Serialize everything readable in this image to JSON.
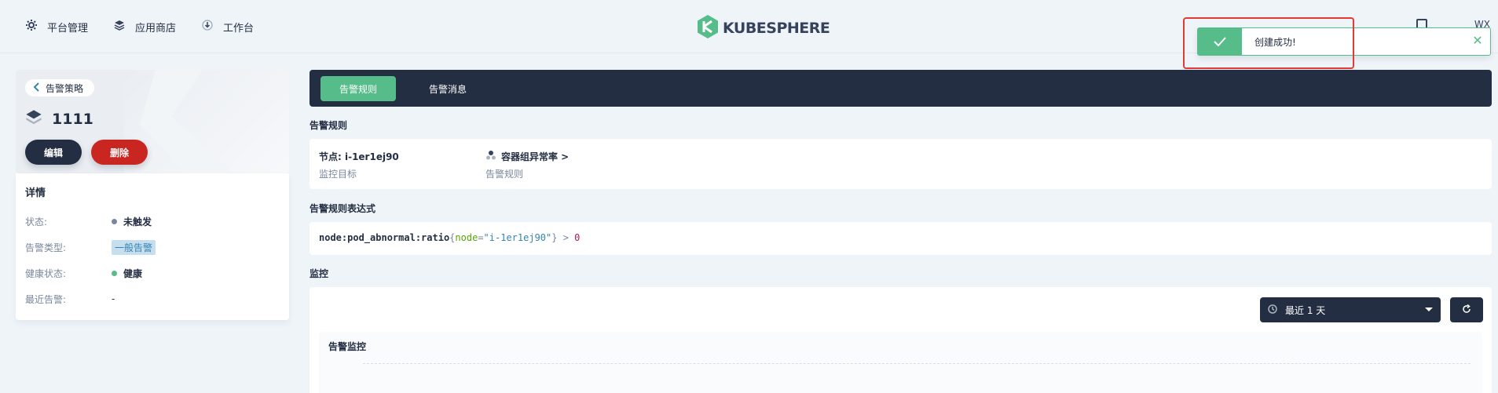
{
  "nav": {
    "items": [
      {
        "label": "平台管理",
        "icon": "gear-icon"
      },
      {
        "label": "应用商店",
        "icon": "layers-icon"
      },
      {
        "label": "工作台",
        "icon": "download-icon"
      }
    ],
    "logo_text": "KUBESPHERE",
    "user_initials": "WX"
  },
  "toast": {
    "message": "创建成功!",
    "icon": "check-icon",
    "close_icon": "close-icon"
  },
  "policy": {
    "back_label": "告警策略",
    "name": "1111",
    "edit_label": "编辑",
    "delete_label": "删除"
  },
  "details": {
    "title": "详情",
    "rows": [
      {
        "label": "状态:",
        "value": "未触发",
        "dot_color": "#79879c"
      },
      {
        "label": "告警类型:",
        "value": "一般告警"
      },
      {
        "label": "健康状态:",
        "value": "健康",
        "dot_color": "#55bc8a"
      },
      {
        "label": "最近告警:",
        "value": "-"
      }
    ]
  },
  "tabs": [
    {
      "label": "告警规则",
      "active": true
    },
    {
      "label": "告警消息",
      "active": false
    }
  ],
  "rules_section": {
    "title": "告警规则",
    "target_value": "节点: i-1er1ej90",
    "target_label": "监控目标",
    "rule_value": "容器组异常率 >",
    "rule_label": "告警规则"
  },
  "expression_section": {
    "title": "告警规则表达式",
    "fn": "node:pod_abnormal:ratio",
    "open": "{",
    "key": "node",
    "eq": "=",
    "str": "\"i-1er1ej90\"",
    "close": "}",
    "op": " > ",
    "num": "0"
  },
  "monitor_section": {
    "title": "监控",
    "time_range": "最近 1 天",
    "chart_title": "告警监控"
  },
  "colors": {
    "accent_green": "#55bc8a",
    "dark": "#242e42",
    "danger": "#ca2621"
  }
}
